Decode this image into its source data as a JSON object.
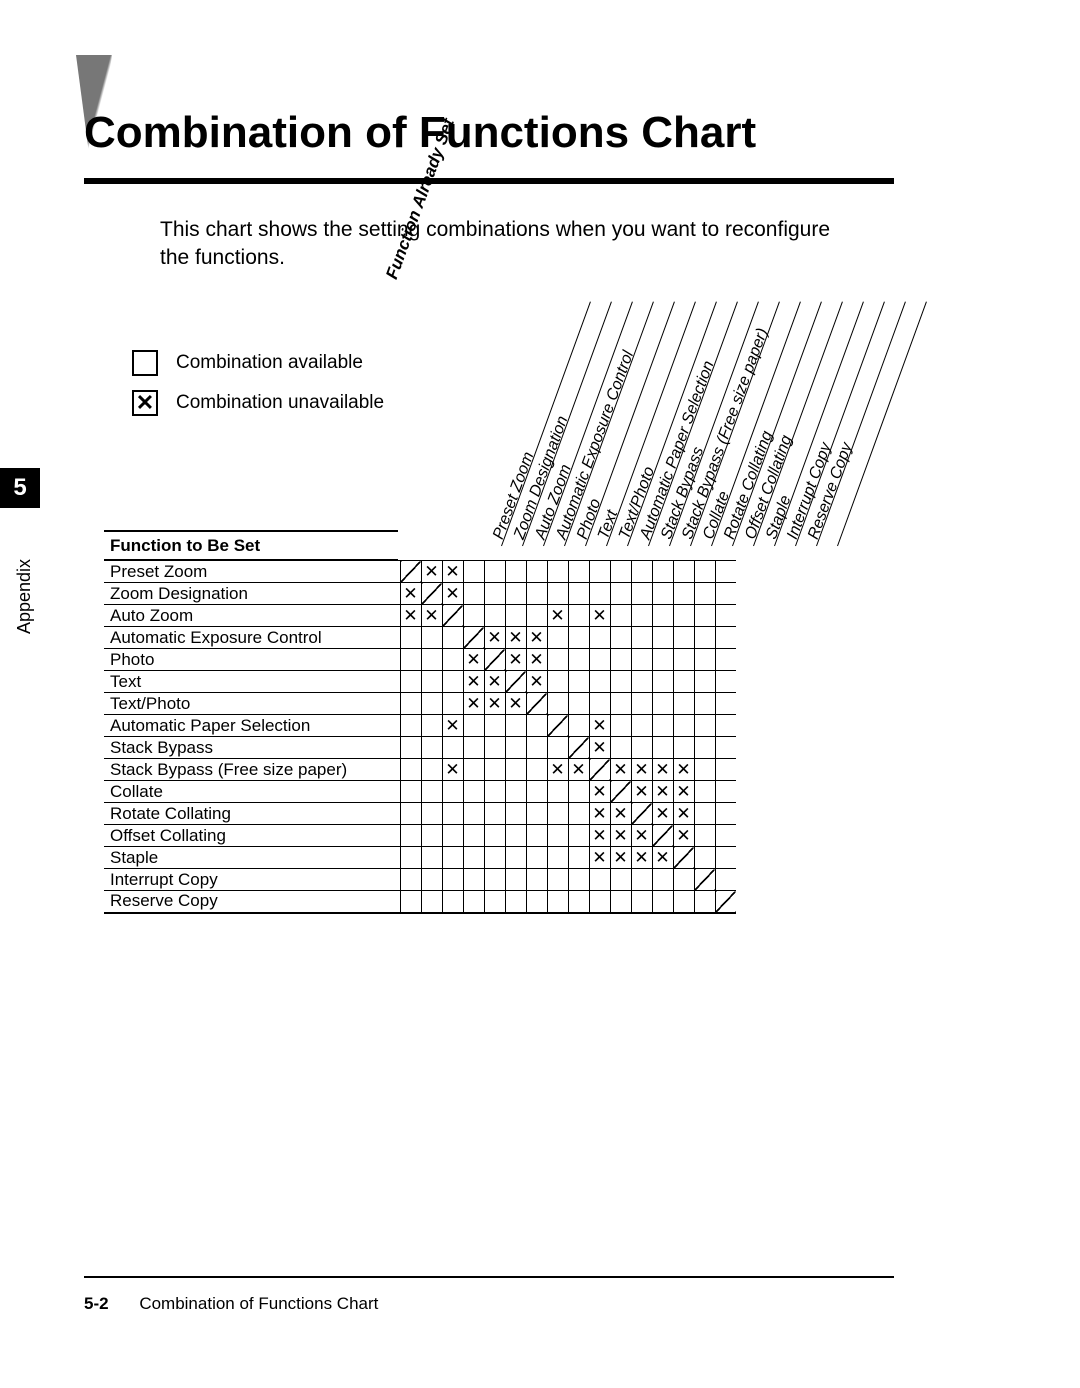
{
  "chapter_number": "5",
  "side_label": "Appendix",
  "title": "Combination of Functions Chart",
  "intro": "This chart shows the setting combinations when you want to reconfigure the functions.",
  "legend": {
    "available": "Combination available",
    "unavailable": "Combination unavailable",
    "x": "✕"
  },
  "function_already_set": "Function Already Set",
  "function_to_be_set": "Function to Be Set",
  "columns": [
    "Preset Zoom",
    "Zoom Designation",
    "Auto Zoom",
    "Automatic Exposure Control",
    "Photo",
    "Text",
    "Text/Photo",
    "Automatic Paper Selection",
    "Stack Bypass",
    "Stack Bypass (Free size paper)",
    "Collate",
    "Rotate Collating",
    "Offset Collating",
    "Staple",
    "Interrupt Copy",
    "Reserve Copy"
  ],
  "rows": [
    "Preset Zoom",
    "Zoom Designation",
    "Auto Zoom",
    "Automatic Exposure Control",
    "Photo",
    "Text",
    "Text/Photo",
    "Automatic Paper Selection",
    "Stack Bypass",
    "Stack Bypass (Free size paper)",
    "Collate",
    "Rotate Collating",
    "Offset Collating",
    "Staple",
    "Interrupt Copy",
    "Reserve Copy"
  ],
  "footer_page": "5-2",
  "footer_text": "Combination of Functions Chart",
  "chart_data": {
    "type": "table",
    "note": "\"X\" means combination unavailable; \"D\" is the diagonal (same-function) cell; empty means combination available.",
    "columns": [
      "Preset Zoom",
      "Zoom Designation",
      "Auto Zoom",
      "Automatic Exposure Control",
      "Photo",
      "Text",
      "Text/Photo",
      "Automatic Paper Selection",
      "Stack Bypass",
      "Stack Bypass (Free size paper)",
      "Collate",
      "Rotate Collating",
      "Offset Collating",
      "Staple",
      "Interrupt Copy",
      "Reserve Copy"
    ],
    "rows": [
      "Preset Zoom",
      "Zoom Designation",
      "Auto Zoom",
      "Automatic Exposure Control",
      "Photo",
      "Text",
      "Text/Photo",
      "Automatic Paper Selection",
      "Stack Bypass",
      "Stack Bypass (Free size paper)",
      "Collate",
      "Rotate Collating",
      "Offset Collating",
      "Staple",
      "Interrupt Copy",
      "Reserve Copy"
    ],
    "matrix": [
      [
        "D",
        "X",
        "X",
        "",
        "",
        "",
        "",
        "",
        "",
        "",
        "",
        "",
        "",
        "",
        "",
        ""
      ],
      [
        "X",
        "D",
        "X",
        "",
        "",
        "",
        "",
        "",
        "",
        "",
        "",
        "",
        "",
        "",
        "",
        ""
      ],
      [
        "X",
        "X",
        "D",
        "",
        "",
        "",
        "",
        "X",
        "",
        "X",
        "",
        "",
        "",
        "",
        "",
        ""
      ],
      [
        "",
        "",
        "",
        "D",
        "X",
        "X",
        "X",
        "",
        "",
        "",
        "",
        "",
        "",
        "",
        "",
        ""
      ],
      [
        "",
        "",
        "",
        "X",
        "D",
        "X",
        "X",
        "",
        "",
        "",
        "",
        "",
        "",
        "",
        "",
        ""
      ],
      [
        "",
        "",
        "",
        "X",
        "X",
        "D",
        "X",
        "",
        "",
        "",
        "",
        "",
        "",
        "",
        "",
        ""
      ],
      [
        "",
        "",
        "",
        "X",
        "X",
        "X",
        "D",
        "",
        "",
        "",
        "",
        "",
        "",
        "",
        "",
        ""
      ],
      [
        "",
        "",
        "X",
        "",
        "",
        "",
        "",
        "D",
        "",
        "X",
        "",
        "",
        "",
        "",
        "",
        ""
      ],
      [
        "",
        "",
        "",
        "",
        "",
        "",
        "",
        "",
        "D",
        "X",
        "",
        "",
        "",
        "",
        "",
        ""
      ],
      [
        "",
        "",
        "X",
        "",
        "",
        "",
        "",
        "X",
        "X",
        "D",
        "X",
        "X",
        "X",
        "X",
        "",
        ""
      ],
      [
        "",
        "",
        "",
        "",
        "",
        "",
        "",
        "",
        "",
        "X",
        "D",
        "X",
        "X",
        "X",
        "",
        ""
      ],
      [
        "",
        "",
        "",
        "",
        "",
        "",
        "",
        "",
        "",
        "X",
        "X",
        "D",
        "X",
        "X",
        "",
        ""
      ],
      [
        "",
        "",
        "",
        "",
        "",
        "",
        "",
        "",
        "",
        "X",
        "X",
        "X",
        "D",
        "X",
        "",
        ""
      ],
      [
        "",
        "",
        "",
        "",
        "",
        "",
        "",
        "",
        "",
        "X",
        "X",
        "X",
        "X",
        "D",
        "",
        ""
      ],
      [
        "",
        "",
        "",
        "",
        "",
        "",
        "",
        "",
        "",
        "",
        "",
        "",
        "",
        "",
        "D",
        ""
      ],
      [
        "",
        "",
        "",
        "",
        "",
        "",
        "",
        "",
        "",
        "",
        "",
        "",
        "",
        "",
        "",
        "D"
      ]
    ]
  }
}
